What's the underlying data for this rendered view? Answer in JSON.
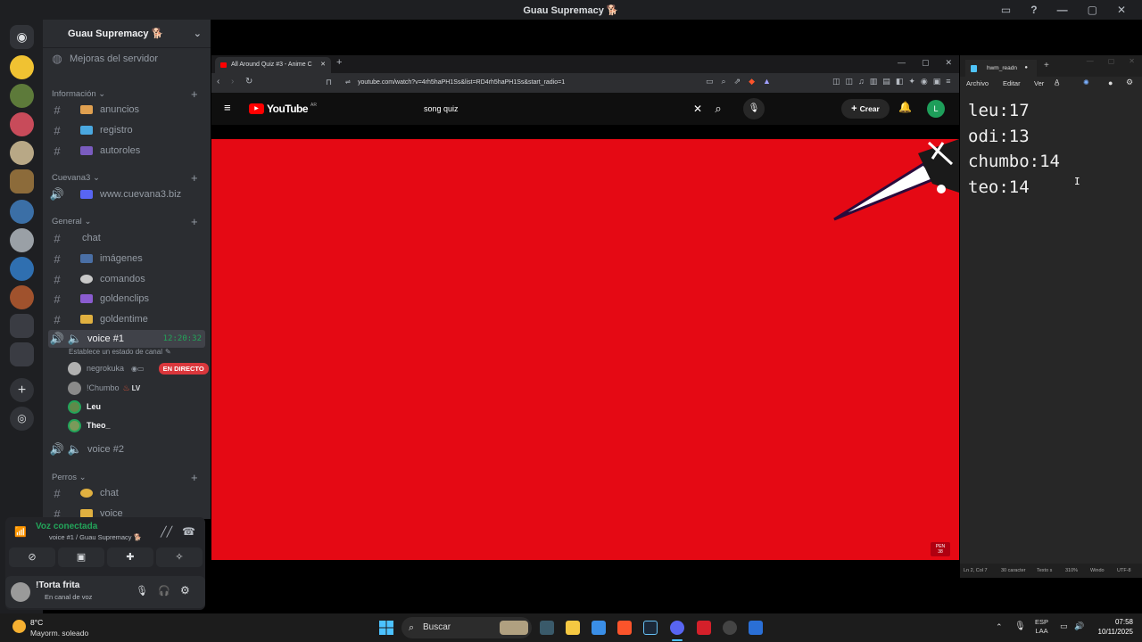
{
  "window": {
    "title": "Guau Supremacy 🐕"
  },
  "discord": {
    "server_name": "Guau Supremacy 🐕",
    "boost": "Mejoras del servidor",
    "categories": [
      "Información",
      "Cuevana3",
      "General",
      "Perros"
    ],
    "channels": {
      "anuncios": "anuncios",
      "registro": "registro",
      "autoroles": "autoroles",
      "cuevana": "www.cuevana3.biz",
      "chat": "chat",
      "imagenes": "imágenes",
      "comandos": "comandos",
      "goldenclips": "goldenclips",
      "goldentime": "goldentime",
      "voice1": "voice #1",
      "voice1_time": "12:20:32",
      "voice1_status": "Establece un estado de canal",
      "voice2": "voice #2",
      "perros_chat": "chat",
      "perros_voice": "voice"
    },
    "users": [
      {
        "name": "negrokuka",
        "badge": "EN DIRECTO"
      },
      {
        "name": "!Chumbo",
        "badge": "LV"
      },
      {
        "name": "Leu",
        "badge": ""
      },
      {
        "name": "Theo_",
        "badge": ""
      }
    ],
    "voice": {
      "status": "Voz conectada",
      "channel": "voice #1 / Guau Supremacy 🐕"
    },
    "me": {
      "name": "!Torta frita",
      "status": "En canal de voz"
    }
  },
  "browser": {
    "tab_title": "All Around Quiz #3 - Anime C",
    "url": "youtube.com/watch?v=4rh5haPH1Ss&list=RD4rh5haPH1Ss&start_radio=1",
    "brand": "YouTube",
    "brand_sup": "AR",
    "search_value": "song quiz",
    "create_label": "Crear",
    "avatar_letter": "L",
    "video_color": "#e50914",
    "badge": "PEN 38"
  },
  "notepad": {
    "tab": "hwm_readn",
    "menus": [
      "Archivo",
      "Editar",
      "Ver"
    ],
    "lines": [
      "leu:17",
      "odi:13",
      "chumbo:14",
      "teo:14"
    ],
    "status": [
      "Ln 2, Col 7",
      "30 caracter",
      "Texto s",
      "310%",
      "Windo",
      "UTF-8"
    ]
  },
  "taskbar": {
    "weather_temp": "8°C",
    "weather_desc": "Mayorm. soleado",
    "search": "Buscar",
    "lang1": "ESP",
    "lang2": "LAA",
    "time": "07:58",
    "date": "10/11/2025"
  },
  "colors": {
    "accent_green": "#23a55a",
    "live": "#da373c",
    "discord_bg": "#2b2d31"
  }
}
